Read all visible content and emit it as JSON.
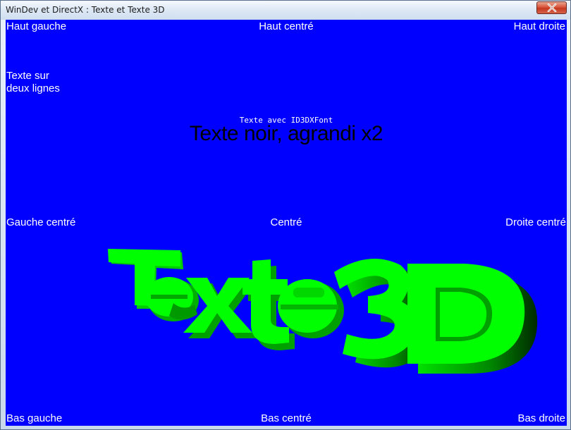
{
  "window": {
    "title": "WinDev et DirectX : Texte et Texte 3D"
  },
  "labels": {
    "top_left": "Haut gauche",
    "top_center": "Haut centré",
    "top_right": "Haut droite",
    "two_lines": "Texte sur\ndeux lignes",
    "middle_left": "Gauche centré",
    "center": "Centré",
    "middle_right": "Droite centré",
    "bottom_left": "Bas gauche",
    "bottom_center": "Bas centré",
    "bottom_right": "Bas droite"
  },
  "d3dxfont_label": "Texte avec ID3DXFont",
  "black_text": "Texte noir, agrandi x2",
  "text_3d": {
    "characters": [
      "T",
      "e",
      "x",
      "t",
      "e",
      " ",
      "3",
      "D"
    ],
    "color": "#00ff00"
  },
  "colors": {
    "background": "#0000ff",
    "label_text": "#ffffff",
    "text_3d": "#00ff00"
  }
}
